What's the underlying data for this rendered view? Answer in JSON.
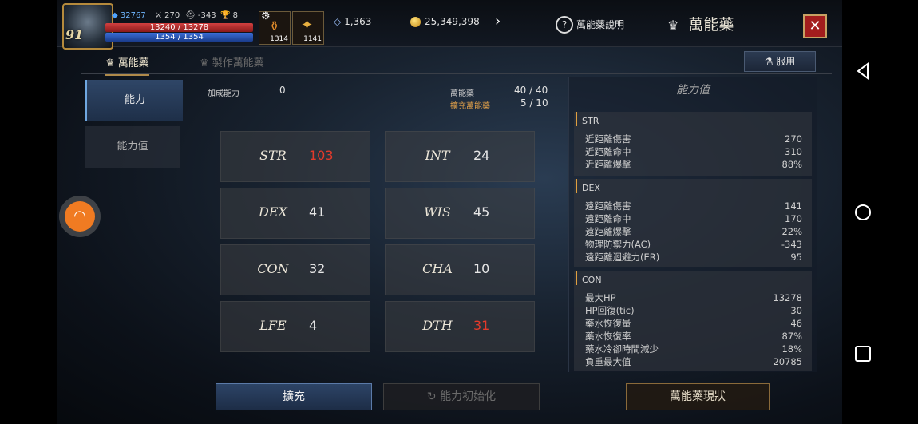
{
  "hud": {
    "level": "91",
    "gem_count": "32767",
    "sword_stat": "270",
    "helmet_stat": "-343",
    "trophy_stat": "8",
    "hp_text": "13240 / 13278",
    "mp_text": "1354 / 1354",
    "item1_count": "1314",
    "item2_count": "1141",
    "crystal": "1,363",
    "gold": "25,349,398",
    "help_label": "萬能藥說明",
    "title": "萬能藥"
  },
  "tabs": {
    "active": "萬能藥",
    "inactive": "製作萬能藥",
    "use_button": "服用"
  },
  "side_menu": {
    "items": [
      "能力",
      "能力值"
    ]
  },
  "middle": {
    "bonus_label": "加成能力",
    "bonus_value": "0",
    "elixir_label": "萬能藥",
    "elixir_value": "40 / 40",
    "expand_label": "擴充萬能藥",
    "expand_value": "5 / 10",
    "stats": [
      {
        "name": "STR",
        "value": "103"
      },
      {
        "name": "INT",
        "value": "24"
      },
      {
        "name": "DEX",
        "value": "41"
      },
      {
        "name": "WIS",
        "value": "45"
      },
      {
        "name": "CON",
        "value": "32"
      },
      {
        "name": "CHA",
        "value": "10"
      },
      {
        "name": "LFE",
        "value": "4"
      },
      {
        "name": "DTH",
        "value": "31"
      }
    ]
  },
  "right_panel": {
    "title": "能力值",
    "groups": [
      {
        "name": "STR",
        "rows": [
          [
            "近距離傷害",
            "270"
          ],
          [
            "近距離命中",
            "310"
          ],
          [
            "近距離爆擊",
            "88%"
          ]
        ]
      },
      {
        "name": "DEX",
        "rows": [
          [
            "遠距離傷害",
            "141"
          ],
          [
            "遠距離命中",
            "170"
          ],
          [
            "遠距離爆擊",
            "22%"
          ],
          [
            "物理防禦力(AC)",
            "-343"
          ],
          [
            "遠距離迴避力(ER)",
            "95"
          ]
        ]
      },
      {
        "name": "CON",
        "rows": [
          [
            "最大HP",
            "13278"
          ],
          [
            "HP回復(tic)",
            "30"
          ],
          [
            "藥水恢復量",
            "46"
          ],
          [
            "藥水恢復率",
            "87%"
          ],
          [
            "藥水冷卻時間減少",
            "18%"
          ],
          [
            "負重最大值",
            "20785"
          ]
        ]
      }
    ]
  },
  "bottom": {
    "expand": "擴充",
    "reset": "能力初始化",
    "status": "萬能藥現狀"
  },
  "colors": {
    "accent_gold": "#b08a4a",
    "stat_red": "#e33a2b",
    "button_blue": "#2d4466"
  }
}
